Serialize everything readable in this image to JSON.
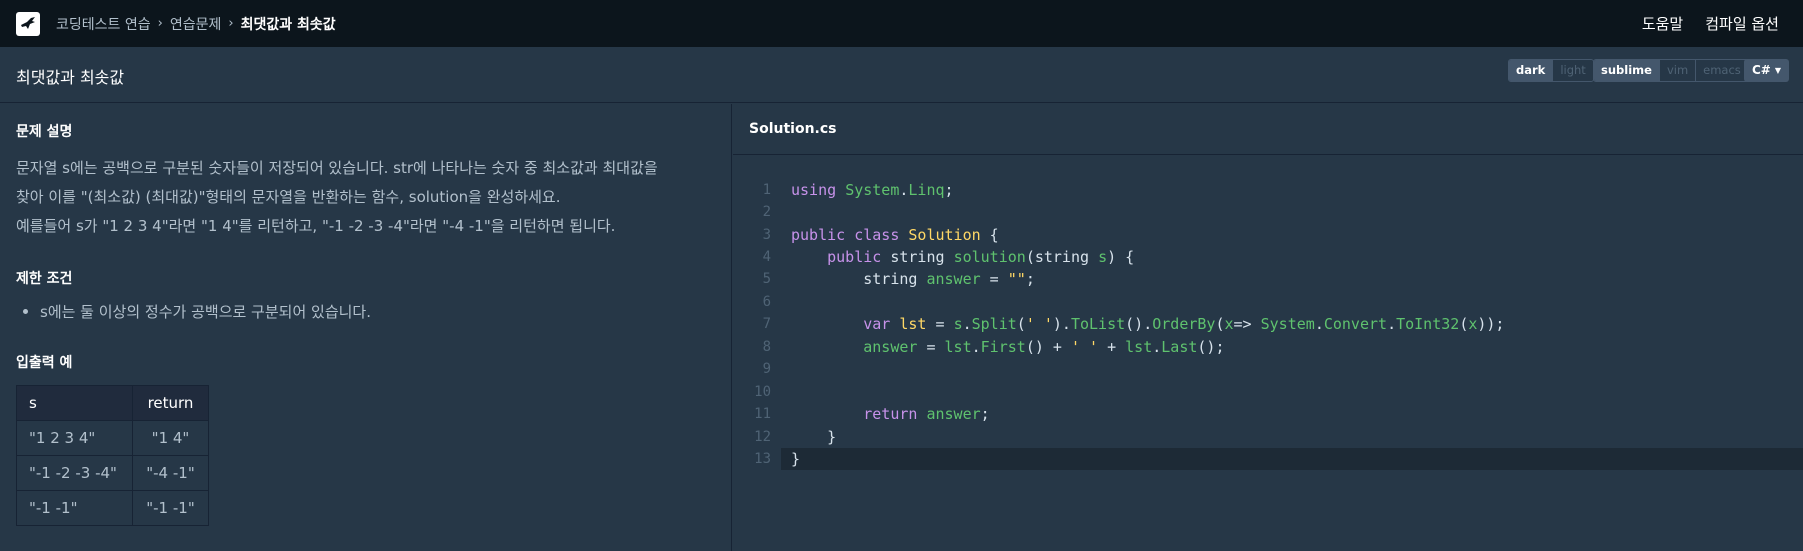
{
  "topnav": {
    "breadcrumb": [
      "코딩테스트 연습",
      "연습문제",
      "최댓값과 최솟값"
    ],
    "help": "도움말",
    "compile_options": "컴파일 옵션"
  },
  "titlebar": {
    "title": "최댓값과 최솟값",
    "themes": [
      "dark",
      "light"
    ],
    "active_theme": "dark",
    "keymaps": [
      "sublime",
      "vim",
      "emacs"
    ],
    "active_keymap": "sublime",
    "language": "C#"
  },
  "problem": {
    "desc_heading": "문제 설명",
    "desc_lines": [
      "문자열 s에는 공백으로 구분된 숫자들이 저장되어 있습니다. str에 나타나는 숫자 중 최소값과 최대값을",
      "찾아 이를 \"(최소값) (최대값)\"형태의 문자열을 반환하는 함수, solution을 완성하세요.",
      "예를들어 s가 \"1 2 3 4\"라면 \"1 4\"를 리턴하고, \"-1 -2 -3 -4\"라면 \"-4 -1\"을 리턴하면 됩니다."
    ],
    "constraints_heading": "제한 조건",
    "constraints": [
      "s에는 둘 이상의 정수가 공백으로 구분되어 있습니다."
    ],
    "examples_heading": "입출력 예",
    "examples": {
      "headers": [
        "s",
        "return"
      ],
      "rows": [
        [
          "\"1 2 3 4\"",
          "\"1 4\""
        ],
        [
          "\"-1 -2 -3 -4\"",
          "\"-4 -1\""
        ],
        [
          "\"-1 -1\"",
          "\"-1 -1\""
        ]
      ]
    }
  },
  "editor": {
    "filename": "Solution.cs",
    "line_numbers": [
      "1",
      "2",
      "3",
      "4",
      "5",
      "6",
      "7",
      "8",
      "9",
      "10",
      "11",
      "12",
      "13"
    ],
    "current_line": 13
  },
  "colors": {
    "nav_bg": "#0c151c",
    "panel_bg": "#263747",
    "keyword": "#c792ea",
    "identifier": "#5fc26e",
    "class_string": "#ffd866"
  }
}
